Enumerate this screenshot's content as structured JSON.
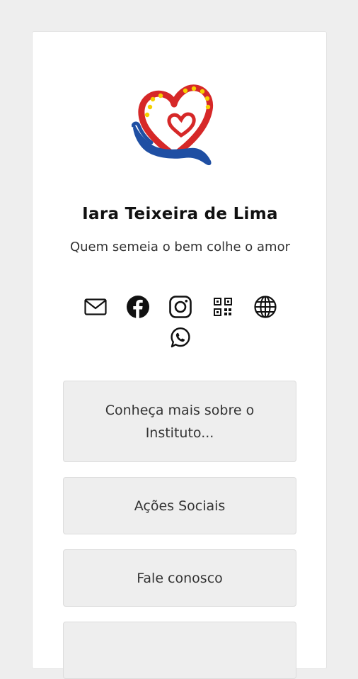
{
  "profile": {
    "name": "Iara Teixeira de Lima",
    "bio": "Quem semeia o bem colhe o amor"
  },
  "brand_colors": {
    "heart_red": "#d62828",
    "hand_blue": "#1f4fa3",
    "star_yellow": "#f5d000"
  },
  "social_icons": [
    {
      "icon": "mail-icon"
    },
    {
      "icon": "facebook-icon"
    },
    {
      "icon": "instagram-icon"
    },
    {
      "icon": "qr-code-icon"
    },
    {
      "icon": "globe-icon"
    },
    {
      "icon": "whatsapp-icon"
    }
  ],
  "links": [
    {
      "label": "Conheça mais sobre o Instituto..."
    },
    {
      "label": "Ações Sociais"
    },
    {
      "label": "Fale conosco"
    },
    {
      "label": ""
    }
  ]
}
